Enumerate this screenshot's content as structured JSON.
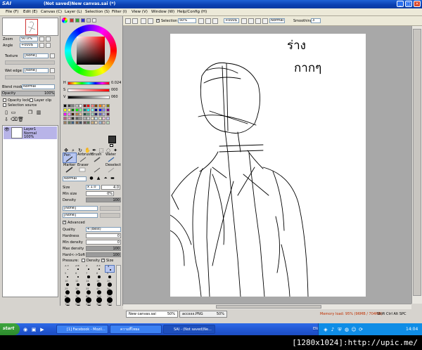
{
  "window": {
    "app_name": "SAI",
    "title": "(Not saved)New canvas.sai (*)"
  },
  "menu": [
    "File (F)",
    "Edit (E)",
    "Canvas (C)",
    "Layer (L)",
    "Selection (S)",
    "Filter (I)",
    "View (V)",
    "Window (W)",
    "Help/Config (H)"
  ],
  "navigator": {
    "zoom_label": "Zoom",
    "zoom_value": "50.0%",
    "angle_label": "Angle",
    "angle_value": "+000$"
  },
  "layer_panel": {
    "texture_label": "Texture",
    "texture_value": "[None]",
    "wetedge_label": "Wet edge",
    "wetedge_value": "[None]",
    "blend_label": "Blend mode",
    "blend_value": "Normal",
    "opacity_label": "Opacity",
    "opacity_value": "100%",
    "opacity_level": 1.0,
    "opacity_lock": "Opacity lock",
    "layer_clip": "Layer clip",
    "selection_source": "Selection source",
    "layers": [
      {
        "name": "Layer1",
        "mode": "Normal",
        "opacity": "100%"
      }
    ]
  },
  "color": {
    "rgb_values": {
      "r": "0.024",
      "s": "000",
      "v": "060"
    }
  },
  "swatch_colors": [
    "#000000",
    "#404040",
    "#808080",
    "#c0c0c0",
    "#ffffff",
    "#800000",
    "#ff0000",
    "#ff8080",
    "#804000",
    "#ff8000",
    "#ffc080",
    "#808000",
    "#ffff00",
    "#ffff80",
    "#008000",
    "#00ff00",
    "#80ff80",
    "#008080",
    "#00ffff",
    "#80ffff",
    "#000080",
    "#0000ff",
    "#8080ff",
    "#800080",
    "#ff00ff",
    "#ff80ff",
    "#402000",
    "#c08040",
    "#e0c0a0",
    "#205040",
    "#60a080",
    "#a0d0c0",
    "#202060",
    "#6060c0",
    "#b0b0e0",
    "#602040",
    "#c06080",
    "#e0b0c0",
    "#303030",
    "#606060",
    "#909090",
    "#b0b0b0",
    "#d0d0d0",
    "#f0e0c0",
    "#c0e0f0",
    "#e0f0c0",
    "#f0c0e0",
    "#c0c0f0",
    "#a08060",
    "#608060",
    "#406080",
    "#806040",
    "#405060",
    "#705050",
    "#557755",
    "#c8a878",
    "#e8d8b8",
    "#98b8d8",
    "#d8b8a8",
    "#b8d8b8"
  ],
  "tools": {
    "row1": [
      "Pen",
      "Airbrush",
      "Brush",
      "Water"
    ],
    "row2": [
      "Marker",
      "Eraser",
      "",
      "Deselect"
    ],
    "mode_value": "Normal",
    "size_label": "Size",
    "size_mult": "x 1.0",
    "size_value": "4.0",
    "minsize_label": "Min size",
    "minsize_value": "0%",
    "density_label": "Density",
    "density_value": "100",
    "brush_none_1": "[None]",
    "brush_none_2": "[None]",
    "advanced_label": "Advanced",
    "quality_label": "Quality",
    "quality_value": "4 (Best)",
    "hardness_label": "Hardness",
    "hardness_value": "0",
    "mindensity_label": "Min density",
    "mindensity_value": "0",
    "maxdensity_label": "Max density",
    "maxdensity_value": "100",
    "hardsoft_label": "Hard<->Soft",
    "hardsoft_value": "100",
    "pressure_label": "Pressure:",
    "pressure_density": "Density",
    "pressure_size": "Size",
    "sizes_row1": [
      "2.3",
      "2.6",
      "3",
      "3.5",
      "4"
    ],
    "sizes_rows": [
      [
        "5",
        "6",
        "7",
        "8",
        "9"
      ],
      [
        "10",
        "12",
        "14",
        "16",
        "20"
      ],
      [
        "25",
        "30",
        "35",
        "40",
        "50"
      ],
      [
        "60",
        "70",
        "80",
        "100",
        "120"
      ],
      [
        "150",
        "200",
        "250",
        "300",
        "350"
      ]
    ]
  },
  "canvas_toolbar": {
    "selection_label": "Selection",
    "zoom_value": "50%",
    "angle_value": "+000$",
    "mode_value": "Normal",
    "smoothing_label": "Smoothing",
    "smoothing_value": "3"
  },
  "status": {
    "tabs": [
      {
        "name": "New canvas.sai",
        "zoom": "50%"
      },
      {
        "name": "accxxx.PNG",
        "zoom": "50%"
      }
    ],
    "memory": "Memory load: 95% (96MB / 704MB)",
    "keys": "Shift Ctrl Alt SPC"
  },
  "taskbar": {
    "start": "start",
    "buttons": [
      "[1] Facebook - Mozil...",
      "ความที่ไทยอ",
      "SAI - (Not saved)Ne..."
    ],
    "lang": "EN",
    "clock": "14:04"
  },
  "drawing": {
    "annotation_line1": "ร่าง",
    "annotation_line2": "กากๆ"
  },
  "caption": "[1280x1024]:http://upic.me/"
}
